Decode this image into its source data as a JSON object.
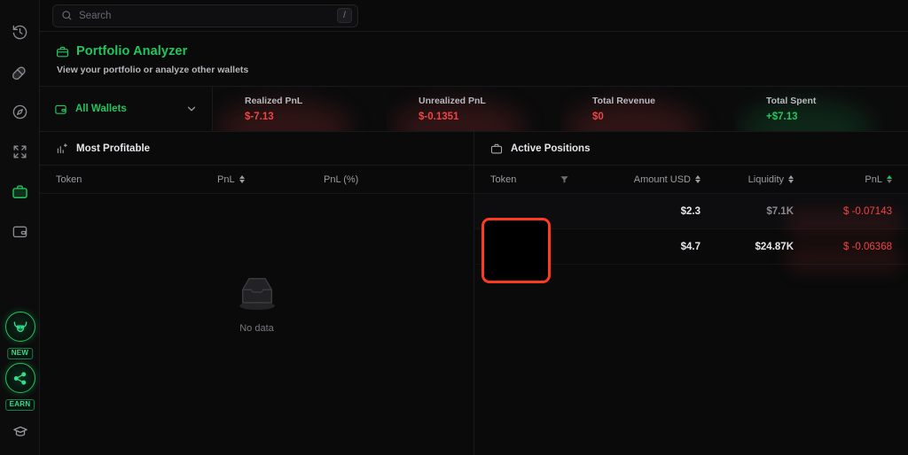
{
  "theme": {
    "accent_green": "#22c55e",
    "negative_red": "#ef4444",
    "annotation_red": "#ff3b1f",
    "background": "#0a0a0a"
  },
  "sidebar": {
    "items": [
      {
        "name": "history",
        "icon": "history-clock-icon",
        "active": false
      },
      {
        "name": "pill",
        "icon": "pill-capsule-icon",
        "active": false
      },
      {
        "name": "discover",
        "icon": "compass-icon",
        "active": false
      },
      {
        "name": "swap",
        "icon": "refresh-swap-icon",
        "active": false
      },
      {
        "name": "portfolio",
        "icon": "briefcase-icon",
        "active": true
      },
      {
        "name": "wallet",
        "icon": "wallet-icon",
        "active": false
      }
    ],
    "promos": [
      {
        "name": "bull",
        "icon": "bull-head-icon",
        "badge": "NEW"
      },
      {
        "name": "referral",
        "icon": "share-network-icon",
        "badge": "EARN"
      }
    ],
    "academy": {
      "icon": "graduation-cap-icon"
    }
  },
  "topbar": {
    "search": {
      "placeholder": "Search",
      "value": "",
      "shortcut": "/",
      "icon": "search-icon"
    }
  },
  "page": {
    "icon": "briefcase-icon",
    "title": "Portfolio Analyzer",
    "subtitle": "View your portfolio or analyze other wallets"
  },
  "wallet_selector": {
    "icon": "wallet-icon",
    "label": "All Wallets",
    "chevron": "chevron-down-icon"
  },
  "stats": [
    {
      "label": "Realized PnL",
      "value": "$-7.13",
      "tone": "neg"
    },
    {
      "label": "Unrealized PnL",
      "value": "$-0.1351",
      "tone": "neg"
    },
    {
      "label": "Total Revenue",
      "value": "$0",
      "tone": "neg"
    },
    {
      "label": "Total Spent",
      "value": "+$7.13",
      "tone": "pos"
    }
  ],
  "most_profitable": {
    "icon": "bar-chart-plus-icon",
    "title": "Most Profitable",
    "columns": [
      {
        "label": "Token",
        "sortable": false
      },
      {
        "label": "PnL",
        "sortable": true,
        "sort_active": false
      },
      {
        "label": "PnL (%)",
        "sortable": false
      }
    ],
    "empty": {
      "icon": "empty-tray-icon",
      "text": "No data"
    },
    "rows": []
  },
  "active_positions": {
    "icon": "briefcase-icon",
    "title": "Active Positions",
    "columns": [
      {
        "label": "Token",
        "sortable": false,
        "filter": true,
        "filter_icon": "filter-icon"
      },
      {
        "label": "Amount USD",
        "sortable": true,
        "sort_active": false
      },
      {
        "label": "Liquidity",
        "sortable": true,
        "sort_active": false
      },
      {
        "label": "PnL",
        "sortable": true,
        "sort_active": true
      }
    ],
    "rows": [
      {
        "token": "",
        "amount_usd": "$2.3",
        "liquidity": "$7.1K",
        "liquidity_tone": "muted",
        "pnl": "$ -0.07143"
      },
      {
        "token": "",
        "amount_usd": "$4.7",
        "liquidity": "$24.87K",
        "liquidity_tone": "bright",
        "pnl": "$ -0.06368"
      }
    ]
  },
  "annotation": {
    "name": "token-cell-highlight",
    "shape": "rounded-rectangle",
    "color": "#ff3b1f"
  }
}
